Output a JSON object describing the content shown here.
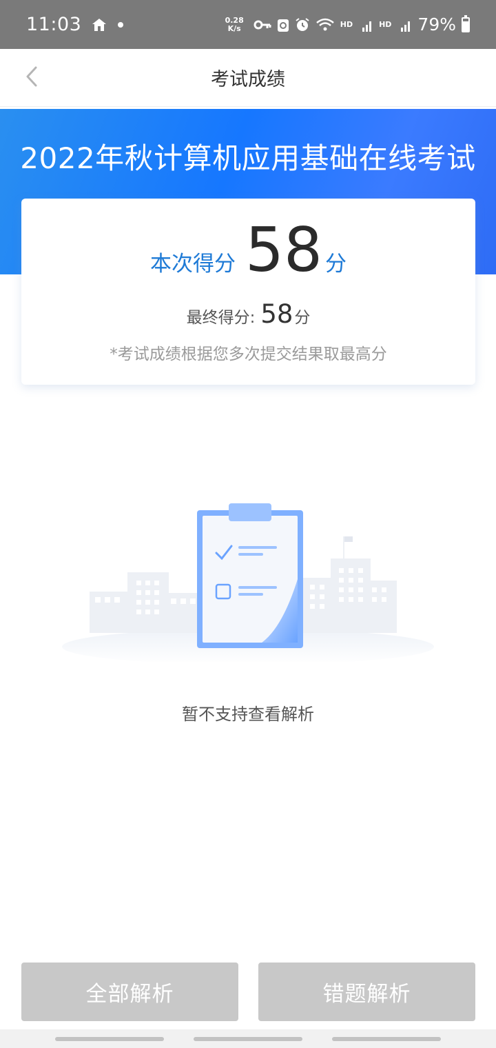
{
  "status_bar": {
    "time": "11:03",
    "net_speed_value": "0.28",
    "net_speed_unit": "K/s",
    "network_1": "HD",
    "network_1_type": "4G",
    "network_2": "HD",
    "network_2_type": "4G",
    "battery_percent": "79%",
    "icons": [
      "home-icon",
      "dot-icon",
      "key-icon",
      "recycle-icon",
      "alarm-icon",
      "wifi-icon",
      "signal-icon",
      "signal-icon",
      "battery-icon"
    ]
  },
  "nav": {
    "back_icon": "chevron-left-icon",
    "title": "考试成绩"
  },
  "hero": {
    "title": "2022年秋计算机应用基础在线考试"
  },
  "score_card": {
    "label": "本次得分",
    "score": "58",
    "unit": "分",
    "final_label": "最终得分:",
    "final_score": "58",
    "final_unit": "分",
    "note": "*考试成绩根据您多次提交结果取最高分"
  },
  "empty_state": {
    "icon": "clipboard-illustration",
    "text": "暂不支持查看解析"
  },
  "buttons": {
    "all_analysis": "全部解析",
    "wrong_analysis": "错题解析"
  },
  "colors": {
    "accent": "#1677ff",
    "score_label": "#1e7ad6",
    "button_disabled": "#c8c8c8",
    "status_bar": "#7a7a7a"
  }
}
